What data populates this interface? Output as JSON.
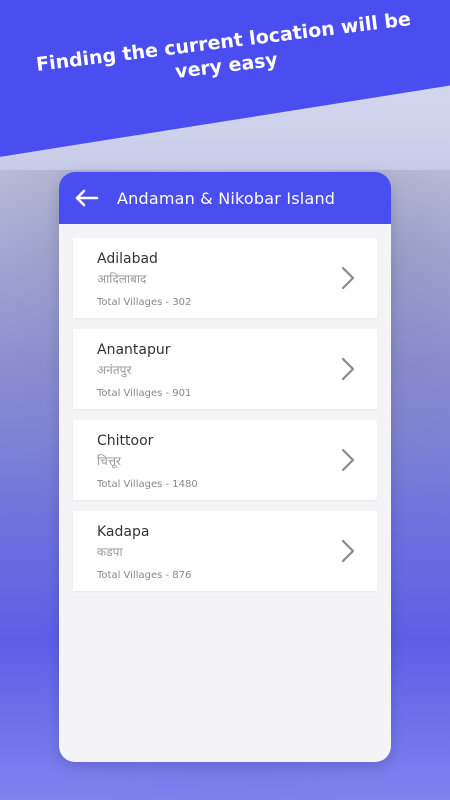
{
  "banner": {
    "text": "Finding the current location will be very easy"
  },
  "header": {
    "title": "Andaman & Nikobar Island",
    "back_icon": "arrow-left-icon"
  },
  "districts": [
    {
      "name": "Adilabad",
      "local_name": "आदिलाबाद",
      "villages_label": "Total Villages - ",
      "villages": "302"
    },
    {
      "name": "Anantapur",
      "local_name": "अनंतपुर",
      "villages_label": "Total Villages - ",
      "villages": "901"
    },
    {
      "name": "Chittoor",
      "local_name": "चित्तूर",
      "villages_label": "Total Villages - ",
      "villages": "1480"
    },
    {
      "name": "Kadapa",
      "local_name": "कडपा",
      "villages_label": "Total Villages - ",
      "villages": "876"
    }
  ],
  "colors": {
    "accent": "#4a4ef0",
    "card_bg": "#f4f4f6"
  }
}
